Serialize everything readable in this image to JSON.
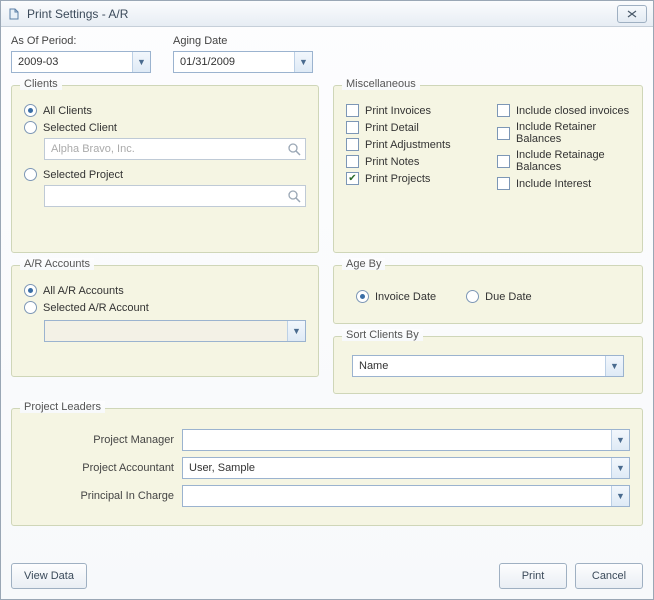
{
  "window": {
    "title": "Print Settings - A/R"
  },
  "fields": {
    "as_of_period_label": "As Of Period:",
    "as_of_period_value": "2009-03",
    "aging_date_label": "Aging Date",
    "aging_date_value": "01/31/2009"
  },
  "clients": {
    "legend": "Clients",
    "all_clients": "All Clients",
    "selected_client": "Selected Client",
    "selected_client_placeholder": "Alpha Bravo, Inc.",
    "selected_project": "Selected Project",
    "selected_project_placeholder": ""
  },
  "misc": {
    "legend": "Miscellaneous",
    "left": {
      "print_invoices": "Print Invoices",
      "print_detail": "Print Detail",
      "print_adjustments": "Print Adjustments",
      "print_notes": "Print Notes",
      "print_projects": "Print Projects"
    },
    "right": {
      "include_closed_invoices": "Include closed invoices",
      "include_retainer_balances": "Include Retainer Balances",
      "include_retainage_balances": "Include Retainage Balances",
      "include_interest": "Include Interest"
    }
  },
  "ar_accounts": {
    "legend": "A/R Accounts",
    "all": "All A/R Accounts",
    "selected": "Selected A/R Account",
    "selected_value": ""
  },
  "age_by": {
    "legend": "Age By",
    "invoice_date": "Invoice Date",
    "due_date": "Due Date"
  },
  "sort_clients": {
    "legend": "Sort Clients By",
    "value": "Name"
  },
  "project_leaders": {
    "legend": "Project Leaders",
    "pm_label": "Project Manager",
    "pm_value": "",
    "pa_label": "Project Accountant",
    "pa_value": "User, Sample",
    "pic_label": "Principal In Charge",
    "pic_value": ""
  },
  "buttons": {
    "view_data": "View Data",
    "print": "Print",
    "cancel": "Cancel"
  }
}
